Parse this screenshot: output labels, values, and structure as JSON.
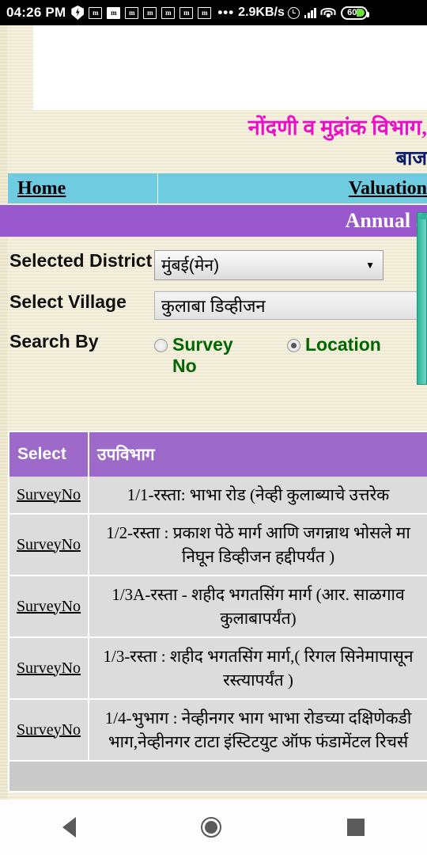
{
  "statusbar": {
    "clock": "04:26 PM",
    "icons": [
      "shield-icon",
      "m-badge-icon",
      "m-badge-filled-icon",
      "m-badge-icon",
      "m-badge-icon",
      "m-badge-icon",
      "m-badge-icon",
      "m-badge-icon"
    ],
    "m_letter": "m",
    "overflow_dots": "•••",
    "network_speed": "2.9KB/s",
    "battery_level": "60"
  },
  "header": {
    "title_marathi": "नोंदणी व मुद्रांक विभाग,",
    "subtitle_marathi": "बाज",
    "title_color": "#e910c8",
    "subtitle_color": "#0b1a6b"
  },
  "nav": {
    "home": "Home",
    "valuation": "Valuation",
    "bar_color": "#6fcbe0"
  },
  "annual_bar": {
    "text": "Annual S",
    "bg_color": "#9a58cf"
  },
  "form": {
    "district_label": "Selected District",
    "district_value": "मुंबई(मेन)",
    "district_caret": "▼",
    "village_label": "Select Village",
    "village_value": "कुलाबा डिव्हीजन",
    "search_by_label": "Search By",
    "radio_survey_label": "Survey No",
    "radio_location_label": "Location",
    "selected_radio": "Location",
    "radio_label_color": "#006600"
  },
  "table": {
    "header_select": "Select",
    "header_subdivision": "उपविभाग",
    "header_bg": "#9d6ac9",
    "link_label": "SurveyNo",
    "rows": [
      {
        "select": "SurveyNo",
        "line1": "1/1-रस्ता: भाभा रोड (नेव्ही कुलाब्याचे उत्तरेक",
        "line2": ""
      },
      {
        "select": "SurveyNo",
        "line1": "1/2-रस्ता : प्रकाश पेठे मार्ग आणि जगन्नाथ भोसले मा",
        "line2": "निघून डिव्हीजन हद्दीपर्यंत )"
      },
      {
        "select": "SurveyNo",
        "line1": "1/3A-रस्ता - शहीद भगतसिंग मार्ग (आर. साळगाव",
        "line2": "कुलाबापर्यंत)"
      },
      {
        "select": "SurveyNo",
        "line1": "1/3-रस्ता : शहीद भगतसिंग मार्ग,( रिगल सिनेमापासून",
        "line2": "रस्त्यापर्यंत )"
      },
      {
        "select": "SurveyNo",
        "line1": "1/4-भुभाग : नेव्हीनगर भाग भाभा रोडच्या दक्षिणेकडी",
        "line2": "भाग,नेव्हीनगर टाटा इंस्टिटयुट ऑफ फंडामेंटल रिचर्स"
      }
    ]
  },
  "android_nav": {
    "back": "back-triangle",
    "home": "home-circle",
    "recents": "recents-square"
  }
}
